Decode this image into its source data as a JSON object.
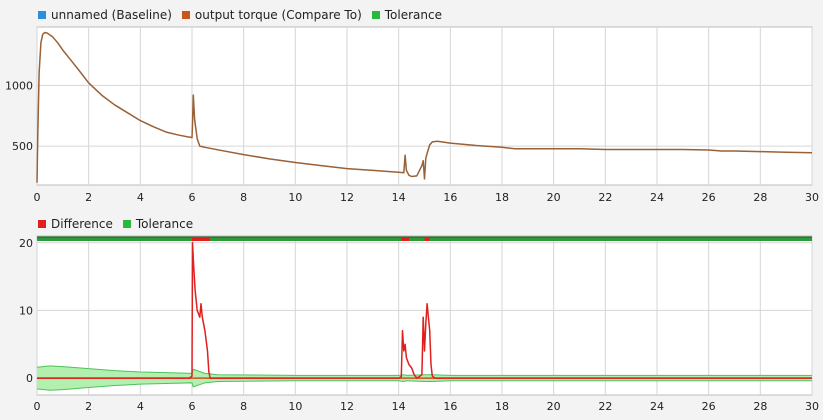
{
  "colors": {
    "baseline": "#2a8fe0",
    "compare": "#c8541e",
    "compare_line": "#9a6036",
    "tolerance_top": "#2bb640",
    "difference": "#e01f1f",
    "tolerance_fill": "#b3f0b0",
    "tolerance_edge": "#4fc15c",
    "grid": "#d6d6d6"
  },
  "chart_data": [
    {
      "type": "line",
      "legend_position": "top-left",
      "grid": true,
      "legend": [
        {
          "label": "unnamed (Baseline)",
          "color_key": "baseline"
        },
        {
          "label": "output torque (Compare To)",
          "color_key": "compare"
        },
        {
          "label": "Tolerance",
          "color_key": "tolerance_top"
        }
      ],
      "xlim": [
        0,
        30
      ],
      "ylim": [
        180,
        1480
      ],
      "xticks": [
        0,
        2,
        4,
        6,
        8,
        10,
        12,
        14,
        16,
        18,
        20,
        22,
        24,
        26,
        28,
        30
      ],
      "yticks": [
        500,
        1000
      ],
      "series": [
        {
          "name": "output torque (Compare To)",
          "x": [
            0,
            0.03,
            0.08,
            0.15,
            0.22,
            0.3,
            0.4,
            0.6,
            0.8,
            1.0,
            1.3,
            1.6,
            2.0,
            2.5,
            3.0,
            3.5,
            4.0,
            4.5,
            5.0,
            5.5,
            6.0,
            6.02,
            6.05,
            6.1,
            6.2,
            6.3,
            6.5,
            7,
            8,
            9,
            10,
            11,
            12,
            13,
            14.0,
            14.2,
            14.25,
            14.3,
            14.4,
            14.5,
            14.7,
            14.9,
            14.95,
            15.0,
            15.05,
            15.1,
            15.2,
            15.3,
            15.5,
            16,
            17,
            18,
            18.5,
            19,
            20,
            21,
            22,
            23,
            24,
            25,
            26,
            26.5,
            27,
            28,
            29,
            30
          ],
          "y": [
            200,
            600,
            1100,
            1350,
            1420,
            1435,
            1430,
            1400,
            1350,
            1290,
            1210,
            1130,
            1020,
            920,
            840,
            775,
            710,
            660,
            615,
            590,
            570,
            680,
            920,
            720,
            560,
            500,
            490,
            470,
            430,
            395,
            365,
            340,
            315,
            300,
            285,
            280,
            425,
            300,
            260,
            250,
            255,
            340,
            380,
            230,
            400,
            440,
            510,
            535,
            540,
            525,
            505,
            490,
            478,
            478,
            478,
            478,
            472,
            472,
            472,
            472,
            468,
            460,
            460,
            455,
            450,
            445
          ]
        }
      ]
    },
    {
      "type": "area",
      "legend_position": "top-left",
      "grid": true,
      "legend": [
        {
          "label": "Difference",
          "color_key": "difference"
        },
        {
          "label": "Tolerance",
          "color_key": "tolerance_top"
        }
      ],
      "xlim": [
        0,
        30
      ],
      "ylim": [
        -2.5,
        21
      ],
      "xticks": [
        0,
        2,
        4,
        6,
        8,
        10,
        12,
        14,
        16,
        18,
        20,
        22,
        24,
        26,
        28,
        30
      ],
      "yticks": [
        0,
        10,
        20
      ],
      "tolerance": {
        "x": [
          0,
          0.5,
          1.0,
          2,
          3,
          4,
          5,
          6.0,
          6.05,
          6.5,
          7,
          10,
          14.0,
          14.2,
          14.3,
          15.0,
          15.3,
          16,
          17,
          17.5,
          18,
          20,
          25,
          30
        ],
        "upper": [
          1.6,
          1.8,
          1.7,
          1.4,
          1.1,
          0.9,
          0.8,
          0.7,
          1.3,
          0.7,
          0.5,
          0.4,
          0.4,
          0.5,
          0.4,
          0.5,
          0.5,
          0.4,
          0.4,
          0.4,
          0.4,
          0.4,
          0.4,
          0.4
        ],
        "lower": [
          -1.6,
          -1.8,
          -1.7,
          -1.4,
          -1.1,
          -0.9,
          -0.8,
          -0.7,
          -1.3,
          -0.7,
          -0.5,
          -0.4,
          -0.4,
          -0.5,
          -0.4,
          -0.5,
          -0.5,
          -0.4,
          -0.4,
          -0.4,
          -0.4,
          -0.4,
          -0.4,
          -0.4
        ]
      },
      "series": [
        {
          "name": "Difference",
          "x": [
            0,
            5.9,
            6.0,
            6.02,
            6.06,
            6.12,
            6.2,
            6.3,
            6.35,
            6.4,
            6.5,
            6.6,
            6.65,
            6.7,
            13.9,
            14.0,
            14.1,
            14.15,
            14.2,
            14.25,
            14.3,
            14.4,
            14.5,
            14.6,
            14.7,
            14.8,
            14.9,
            14.95,
            15.0,
            15.05,
            15.1,
            15.15,
            15.2,
            15.25,
            15.3,
            15.4,
            30
          ],
          "y": [
            0,
            0,
            0.3,
            20,
            17,
            13,
            10,
            9,
            11,
            9,
            7,
            4,
            1,
            0,
            0,
            0,
            0.2,
            7,
            4,
            5,
            3,
            2,
            1.5,
            0.5,
            0,
            0.2,
            0.5,
            9,
            4,
            8,
            11,
            9,
            7,
            2,
            0.3,
            0,
            0
          ]
        }
      ],
      "top_band": {
        "name": "Tolerance",
        "fail_segments": [
          [
            6.0,
            6.7
          ],
          [
            14.1,
            14.4
          ],
          [
            15.0,
            15.2
          ]
        ]
      }
    }
  ]
}
